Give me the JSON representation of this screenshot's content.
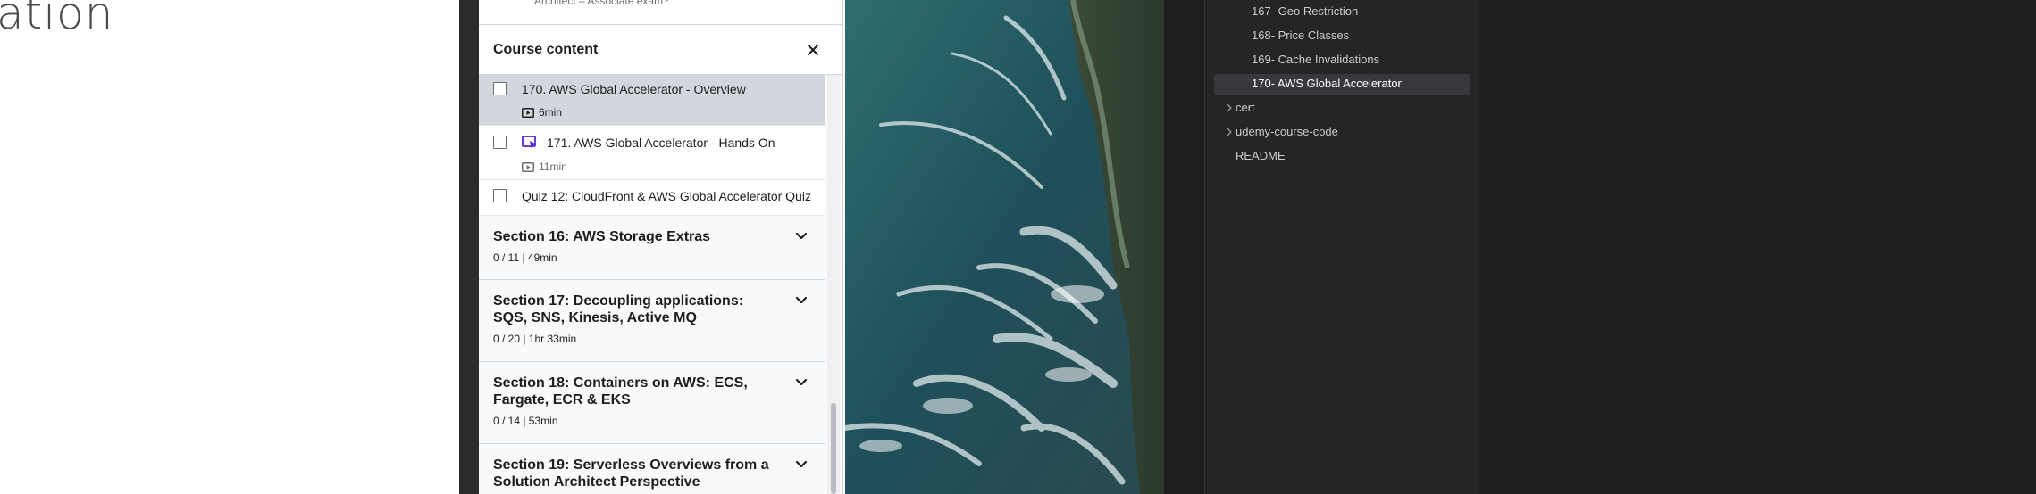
{
  "left_page": {
    "heading_fragment": "ation"
  },
  "course_panel": {
    "previous_item_text": "Architect – Associate exam?",
    "title": "Course content",
    "lectures": [
      {
        "title": "170. AWS Global Accelerator - Overview",
        "duration": "6min",
        "active": true
      },
      {
        "title": "171. AWS Global Accelerator - Hands On",
        "duration": "11min",
        "active": false
      },
      {
        "title": "Quiz 12: CloudFront & AWS Global Accelerator Quiz"
      }
    ],
    "sections": [
      {
        "title": "Section 16: AWS Storage Extras",
        "meta": "0 / 11 | 49min"
      },
      {
        "title": "Section 17: Decoupling applications: SQS, SNS, Kinesis, Active MQ",
        "meta": "0 / 20 | 1hr 33min"
      },
      {
        "title": "Section 18: Containers on AWS: ECS, Fargate, ECR & EKS",
        "meta": "0 / 14 | 53min"
      },
      {
        "title": "Section 19: Serverless Overviews from a Solution Architect Perspective"
      }
    ]
  },
  "explorer": {
    "items": [
      {
        "label": "167- Geo Restriction"
      },
      {
        "label": "168- Price Classes"
      },
      {
        "label": "169- Cache Invalidations"
      },
      {
        "label": "170- AWS Global Accelerator",
        "selected": true
      },
      {
        "label": "cert",
        "folder": true
      },
      {
        "label": "udemy-course-code",
        "folder": true
      },
      {
        "label": "README"
      }
    ]
  },
  "colors": {
    "panel_bg": "#f7f9fa",
    "active_lecture_bg": "#d1d7dc",
    "resume_icon_purple": "#5624d0",
    "explorer_bg": "#252526",
    "explorer_selected_bg": "#37373d"
  }
}
